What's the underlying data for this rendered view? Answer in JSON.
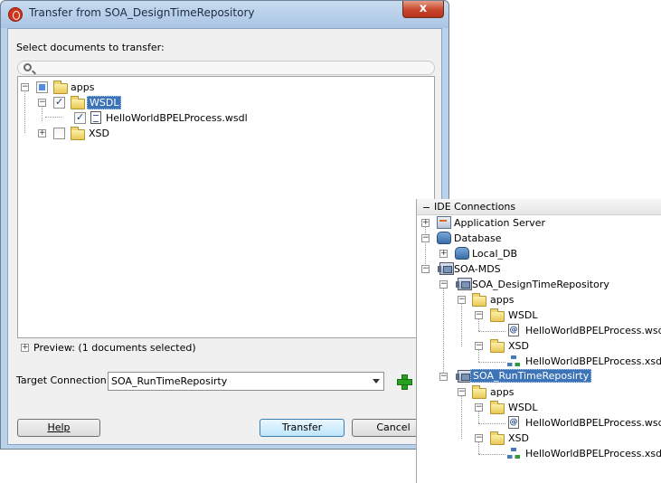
{
  "dialog": {
    "title": "Transfer from SOA_DesignTimeRepository",
    "close_label": "x",
    "select_label": "Select documents to transfer:",
    "search_placeholder": "",
    "tree": {
      "apps": "apps",
      "wsdl": "WSDL",
      "wsdl_file": "HelloWorldBPELProcess.wsdl",
      "xsd": "XSD"
    },
    "preview_label": "Preview: (1 documents selected)",
    "target_label": "Target Connection:",
    "target_value": "SOA_RunTimeReposirty",
    "help_button": "Help",
    "transfer_button": "Transfer",
    "cancel_button": "Cancel"
  },
  "ide": {
    "header": "IDE Connections",
    "app_server": "Application Server",
    "database": "Database",
    "local_db": "Local_DB",
    "soa_mds": "SOA-MDS",
    "design_repo": "SOA_DesignTimeRepository",
    "runtime_repo": "SOA_RunTimeReposirty",
    "apps": "apps",
    "wsdl": "WSDL",
    "wsdl_file": "HelloWorldBPELProcess.wsdl",
    "xsd": "XSD",
    "xsd_file": "HelloWorldBPELProcess.xsd"
  },
  "colors": {
    "selection": "#3d74b7",
    "titlebar": "#b9d1ea",
    "close_button": "#c7462b"
  }
}
